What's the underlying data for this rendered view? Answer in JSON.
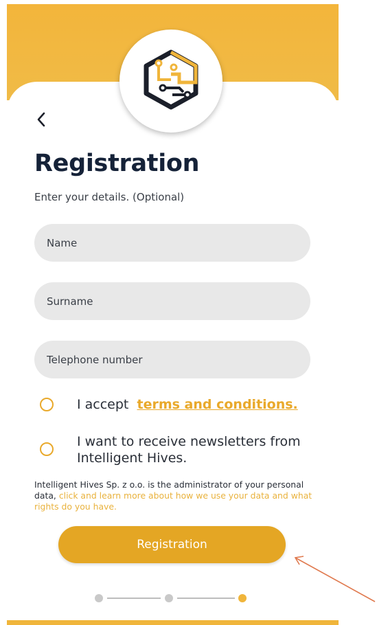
{
  "header": {
    "logo_icon": "circuit-hexagon-logo-icon",
    "back_icon": "chevron-left-icon"
  },
  "page": {
    "title": "Registration",
    "subtitle": "Enter your details. (Optional)"
  },
  "form": {
    "name_placeholder": "Name",
    "surname_placeholder": "Surname",
    "phone_placeholder": "Telephone number"
  },
  "options": {
    "terms_prefix": "I accept",
    "terms_link": "terms and conditions.",
    "newsletter_text": "I want to receive newsletters from Intelligent Hives."
  },
  "notice": {
    "admin_text": "Intelligent Hives Sp. z o.o. is the administrator of your personal data,",
    "admin_link": "click and learn more about how we use your data and what rights do you have."
  },
  "actions": {
    "register_label": "Registration"
  },
  "stepper": {
    "total_steps": 3,
    "current_step": 3
  },
  "colors": {
    "accent": "#f0b53b",
    "button": "#e4a624",
    "title": "#152238",
    "field_bg": "#e8e8e8",
    "annotation_arrow": "#e07a4f"
  }
}
